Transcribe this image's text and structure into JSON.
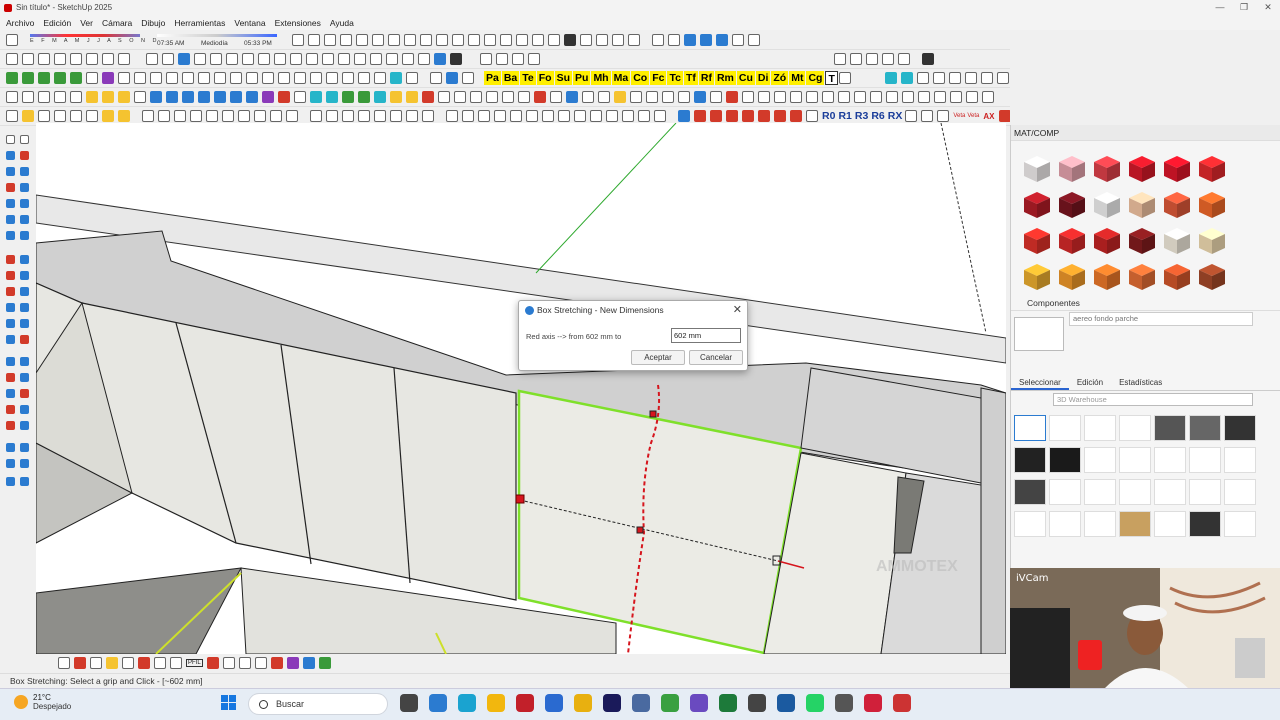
{
  "window": {
    "title": "Sin título* - SketchUp 2025",
    "controls": [
      "—",
      "❐",
      "✕"
    ]
  },
  "menu": [
    "Archivo",
    "Edición",
    "Ver",
    "Cámara",
    "Dibujo",
    "Herramientas",
    "Ventana",
    "Extensiones",
    "Ayuda"
  ],
  "shadow": {
    "months": "E F M A M J J A S O N D",
    "time_start": "07:35 AM",
    "time_mid": "Mediodía",
    "time_end": "05:33 PM"
  },
  "toolbar_labels": [
    "Pa",
    "Ba",
    "Te",
    "Fo",
    "Su",
    "Pu",
    "Mh",
    "Ma",
    "Co",
    "Fc",
    "Tc",
    "Tf",
    "Rf",
    "Rm",
    "Cu",
    "Di",
    "Zó",
    "Mt",
    "Cg",
    "T"
  ],
  "rotate_labels": [
    "R0",
    "R1",
    "R3",
    "R6",
    "RX"
  ],
  "veta": {
    "v1": "Veta",
    "v2": "Veta",
    "ax": "AX"
  },
  "bottom_bar": {
    "pfil": "PFIL"
  },
  "dialog": {
    "title": "Box Stretching - New Dimensions",
    "prompt": "Red axis --> from 602 mm to",
    "value": "602 mm",
    "accept": "Aceptar",
    "cancel": "Cancelar"
  },
  "status_text": "Box Stretching: Select a grip and Click - [~602 mm]",
  "panel": {
    "title": "MAT/COMP",
    "components_header": "Componentes",
    "component_name": "aereo fondo parche",
    "tabs": [
      "Seleccionar",
      "Edición",
      "Estadísticas"
    ],
    "search_placeholder": "3D Warehouse"
  },
  "materials": [
    "#f4f0f0",
    "#e9a6b0",
    "#e2424b",
    "#d81a2a",
    "#e0162a",
    "#e52a2e",
    "#b51d28",
    "#7a1520",
    "#f4f4f4",
    "#f6c7a5",
    "#e15a3a",
    "#f36a2a",
    "#e1322a",
    "#d72a2a",
    "#c72525",
    "#851c1e",
    "#f6efe0",
    "#f5e0b5",
    "#f0b030",
    "#f29a2a",
    "#f07a2a",
    "#e87036",
    "#d6582c",
    "#a74a2a"
  ],
  "webcam": {
    "label": "iVCam"
  },
  "watermark": "AMMOTEX",
  "taskbar": {
    "temp": "21°C",
    "weather": "Despejado",
    "search": "Buscar"
  },
  "colors": {
    "accent": "#2b7bd0",
    "selection": "#7fe02a",
    "axis_red": "#d6151d",
    "axis_green": "#2ea92e",
    "label_yellow": "#ffef00"
  }
}
